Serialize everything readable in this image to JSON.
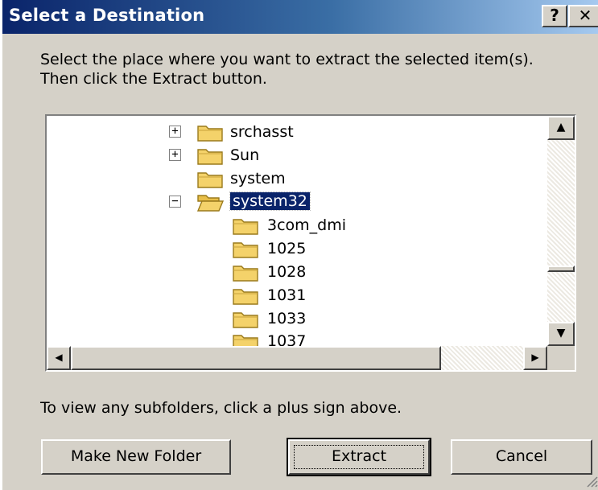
{
  "window": {
    "title": "Select a Destination",
    "help_label": "?",
    "close_label": "✕"
  },
  "instructions": "Select the place where you want to extract the selected item(s).  Then click the Extract button.",
  "tree": {
    "items": [
      {
        "label": "srchasst",
        "expander": "+",
        "selected": false
      },
      {
        "label": "Sun",
        "expander": "+",
        "selected": false
      },
      {
        "label": "system",
        "expander": "",
        "selected": false
      },
      {
        "label": "system32",
        "expander": "−",
        "selected": true
      },
      {
        "label": "3com_dmi",
        "expander": "",
        "selected": false
      },
      {
        "label": "1025",
        "expander": "",
        "selected": false
      },
      {
        "label": "1028",
        "expander": "",
        "selected": false
      },
      {
        "label": "1031",
        "expander": "",
        "selected": false
      },
      {
        "label": "1033",
        "expander": "",
        "selected": false
      },
      {
        "label": "1037",
        "expander": "",
        "selected": false
      }
    ]
  },
  "scrollbar": {
    "up_arrow": "▲",
    "down_arrow": "▼",
    "left_arrow": "◀",
    "right_arrow": "▶"
  },
  "hint": "To view any subfolders, click a plus sign above.",
  "buttons": {
    "make_new_folder": "Make New Folder",
    "extract": "Extract",
    "cancel": "Cancel"
  },
  "colors": {
    "title_bar_start": "#0a246a",
    "title_bar_end": "#a6caf0",
    "dialog_face": "#d5d1c8",
    "selection": "#0a246a",
    "folder": "#f4d26a"
  },
  "icons": {
    "folder": "folder-icon",
    "open_folder": "folder-open-icon",
    "expand": "plus-box-icon",
    "collapse": "minus-box-icon",
    "resize": "resize-grip-icon"
  }
}
